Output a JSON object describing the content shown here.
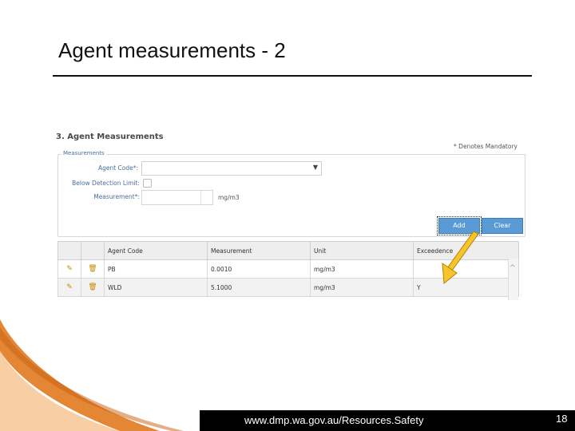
{
  "slide": {
    "title": "Agent measurements - 2",
    "footer_url": "www.dmp.wa.gov.au/Resources.Safety",
    "page_number": "18"
  },
  "form": {
    "section_heading": "3.  Agent Measurements",
    "mandatory_note": "* Denotes Mandatory",
    "fieldset_legend": "Measurements",
    "agent_code_label": "Agent Code*:",
    "agent_code_value": "",
    "below_detection_label": "Below Detection Limit:",
    "measurement_label": "Measurement*:",
    "measurement_value": "",
    "unit_label": "mg/m3",
    "add_label": "Add",
    "clear_label": "Clear"
  },
  "grid": {
    "columns": [
      "Agent Code",
      "Measurement",
      "Unit",
      "Exceedence"
    ],
    "rows": [
      {
        "agent_code": "PB",
        "measurement": "0.0010",
        "unit": "mg/m3",
        "exceedence": ""
      },
      {
        "agent_code": "WLD",
        "measurement": "5.1000",
        "unit": "mg/m3",
        "exceedence": "Y"
      }
    ]
  },
  "colors": {
    "accent_orange": "#e07a1f",
    "button_blue": "#5b9bd5",
    "arrow_fill": "#f7c52b"
  },
  "icons": [
    "edit-icon",
    "delete-icon",
    "chevron-down-icon",
    "scroll-up-icon"
  ]
}
